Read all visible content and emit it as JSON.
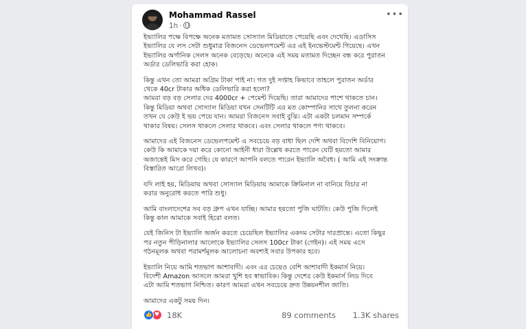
{
  "post": {
    "author": "Mohammad Rassel",
    "time": "1h",
    "paragraphs": [
      [
        "ইভ্যালির পক্ষে বিপক্ষে অনেক মতামত সোস্যাল মিডিয়াতে পেয়েছি এবং দেখেছি। এডাসিস",
        "ইভ্যালির যে লস সেটা শুধুমাত্র বিজনেস ডেভেলপমেন্ট এর এই ইনভেস্টমেন্ট গিয়েছে। এখন",
        "ইভ্যালির অর্গানিক সেলস অনেক বেড়েছে। অনেকে এই সময় মতামত দিচ্ছেন বন্ধ করে পুরাতন",
        "অর্ডার ডেলিভারি করা হোক।"
      ],
      [
        "কিন্তু এখন তো আমরা অগ্রিম টাকা পাই না। গত দুই সপ্তাহ কিভাবে তাহলে পুরাতন অর্ডার",
        "থেকে 40cr টাকার অধিক ডেলিভারি করা হলো?",
        "আমরা বড় বড় সেলার দের 4000cr + পেমেন্ট দিয়েছি। তারা আমাদের পাশে থাকতে চান।",
        "কিন্তু মিডিয়া অথবা সোস্যাল মিডিয়া যখন সেনটিটি এর মত কোম্পানির সাথে তুলনা করেন",
        "তখন যে কেউ ই ভয় পেয়ে যান। আমরা বিজনেস সবাই বুঝি। এটা একটা চলমান সম্পর্কে",
        "থাকার বিষয়। সেলস থাকলে সেলার থাকবে। এবং সেলার থাকলে পণ্য থাকবে।"
      ],
      [
        "আমাদের এই বিজনেস ডেভেলপমেন্ট এ সবচেয়ে বড় বাধা ছিল দেশি অথবা বিদেশি বিনিয়োগ।",
        "কেউ কি আমাকে দয়া করে কোনো আইনী ধারা উল্লেখ করতে পারেন যেটি হয়তো আমার",
        "অজান্তেই মিস করে গেছি। যে কারণে আপনি বলতে পারেন ইভ্যালি অবৈধ। ( আমি এই সংক্রান্ত",
        "বিস্তারিত আরো লিখব)।"
      ],
      [
        "যদি লাই হয়, মিডিয়ায় অথবা সোস্যাল মিডিয়ায় আমাকে ক্রিমিনাল না বানিয়ে বিচার না",
        "করার অনুরোধ করতে পারি শুধু।"
      ],
      [
        "আমি বাংলাদেশের সব বড় গ্রুপ এখন যাচ্ছি। আমার হয়তো পুজি ঘাটতি। কেউ পুজি দিলেই",
        "কিন্তু কাল আমাকে সবাই হিরো বলত।"
      ],
      [
        "যেই জিনিস টা ইভ্যালি অর্জন করতে চেয়েছিল ইভ্যালির একদম সেটার দারপ্রান্তে। এতো কিছুর",
        "পর নতুন পীড়িনালার আলোকে ইভ্যালির সেলস 100cr টাকা (গেইন)। এই সময় এসে",
        "গঠনমূলক অথবা পরামর্শমূলক আলোচনা অবশ্যই সবার উপকার হবে।"
      ],
      [
        "ইভ্যালি নিয়ে আমি শতভাগ আশাবাদী। এবং এর চেয়েও বেশি আশাবাদী ইকমার্স নিয়ে।",
        "বিদেশী Amazon আসলে আমরা খুশি হব স্বাভাবিক। কিন্তু দেশের কেউ ইকমার্স লিড দিবে",
        "এটা আমি শতভাগ নিশ্চিত। কারণ আমরা এখন সবচেয়ে দ্রুত উন্নয়নশীল জাতি।"
      ],
      [
        "আমাদের একটু সময় দিন।"
      ]
    ]
  },
  "engagement": {
    "reactions": "18K",
    "comments": "89 comments",
    "shares": "1.3K shares"
  },
  "icons": {
    "like": "like-icon",
    "love": "love-icon",
    "privacy": "globe-icon",
    "more": "more-options-icon"
  },
  "colors": {
    "background": "#e9ebee",
    "card": "#ffffff",
    "like": "#1877f2",
    "love": "#f33e58",
    "meta": "#65676b"
  }
}
